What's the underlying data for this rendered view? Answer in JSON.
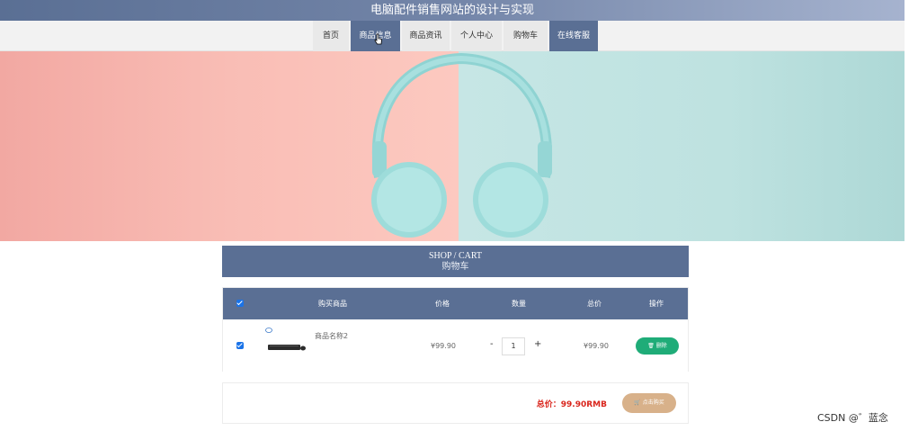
{
  "header": {
    "title": "电脑配件销售网站的设计与实现"
  },
  "nav": {
    "items": [
      {
        "label": "首页",
        "active": false
      },
      {
        "label": "商品信息",
        "active": true
      },
      {
        "label": "商品资讯",
        "active": false
      },
      {
        "label": "个人中心",
        "active": false
      },
      {
        "label": "购物车",
        "active": false
      },
      {
        "label": "在线客服",
        "active": true
      }
    ]
  },
  "cart": {
    "title_en": "SHOP / CART",
    "title_cn": "购物车",
    "columns": [
      "购买商品",
      "价格",
      "数量",
      "总价",
      "操作"
    ],
    "rows": [
      {
        "name": "商品名称2",
        "price": "¥99.90",
        "quantity": "1",
        "total": "¥99.90",
        "delete_label": "删除",
        "checked": true
      }
    ],
    "qty_minus": "-",
    "qty_plus": "+",
    "total_label": "总价：99.90RMB",
    "buy_label": "点击购买"
  },
  "watermark": "CSDN @゛蓝念",
  "colors": {
    "primary": "#5a6f94",
    "delete": "#1fac78",
    "buy": "#d8b18a",
    "total": "#d9251c"
  }
}
